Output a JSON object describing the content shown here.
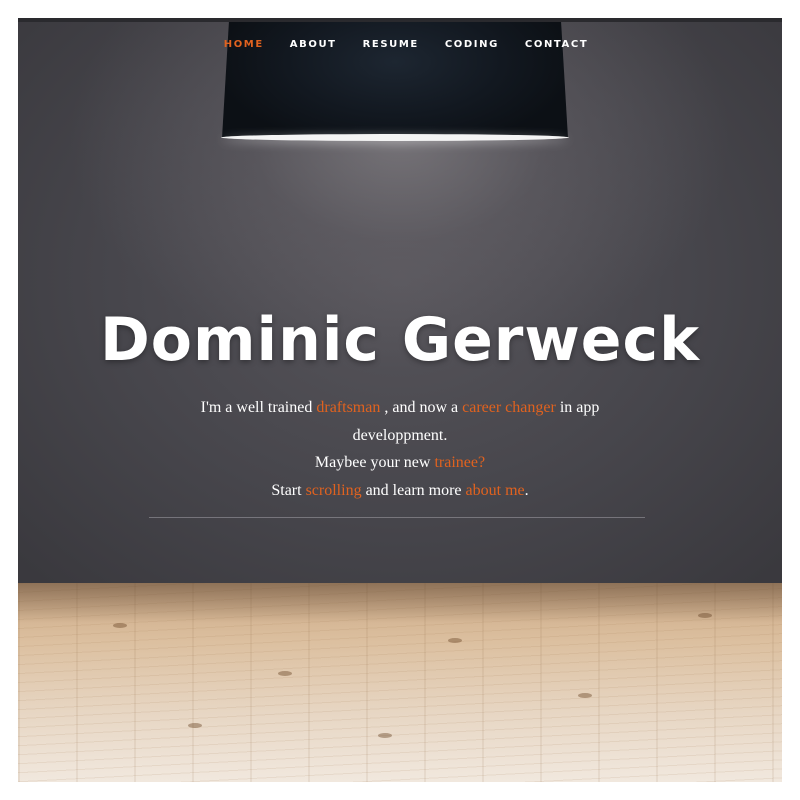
{
  "nav": {
    "items": [
      {
        "label": "HOME",
        "active": true
      },
      {
        "label": "ABOUT",
        "active": false
      },
      {
        "label": "RESUME",
        "active": false
      },
      {
        "label": "CODING",
        "active": false
      },
      {
        "label": "CONTACT",
        "active": false
      }
    ]
  },
  "hero": {
    "title": "Dominic Gerweck",
    "line1": {
      "pre": "I'm a well trained ",
      "link1": "draftsman",
      "mid": " , and now a ",
      "link2": "career changer",
      "post": " in app"
    },
    "line2": "developpment.",
    "line3": {
      "pre": "Maybee your new ",
      "link": "trainee?"
    },
    "line4": {
      "pre": "Start ",
      "link1": "scrolling",
      "mid": " and learn more ",
      "link2": "about me",
      "post": "."
    }
  },
  "colors": {
    "accent": "#e0621f",
    "wall": "#47464c",
    "text": "#ffffff",
    "floor": "#dcc0a0"
  },
  "icons": {
    "lamp": "pendant-lamp-icon"
  }
}
